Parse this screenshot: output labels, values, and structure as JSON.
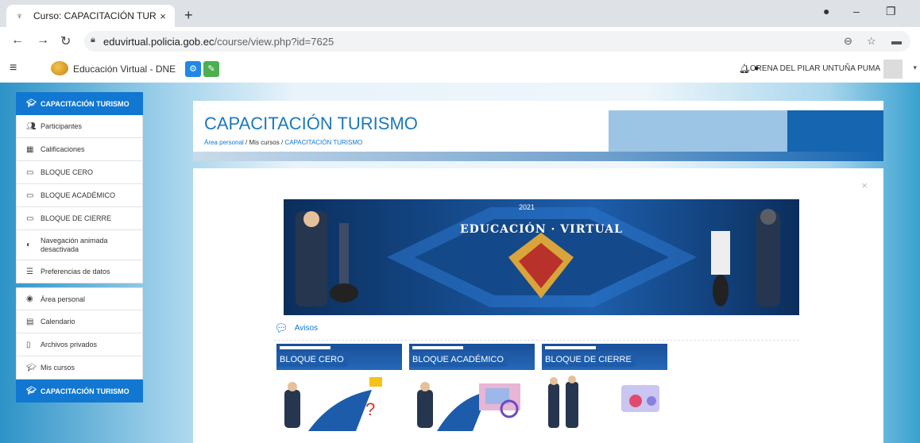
{
  "browser": {
    "tab_title": "Curso: CAPACITACIÓN TURISMO",
    "tab_close": "×",
    "new_tab": "+",
    "url_host": "eduvirtual.policia.gob.ec",
    "url_path": "/course/view.php?id=7625",
    "win_min": "–",
    "win_max": "❐"
  },
  "navbar": {
    "site_name": "Educación Virtual - DNE",
    "user_name": "LORENA DEL PILAR UNTUÑA PUMA"
  },
  "sidebar": {
    "items": [
      {
        "label": "CAPACITACIÓN TURISMO",
        "icon": "graduation-cap-icon"
      },
      {
        "label": "Participantes",
        "icon": "users-icon"
      },
      {
        "label": "Calificaciones",
        "icon": "table-icon"
      },
      {
        "label": "BLOQUE CERO",
        "icon": "folder-icon"
      },
      {
        "label": "BLOQUE ACADÉMICO",
        "icon": "folder-icon"
      },
      {
        "label": "BLOQUE DE CIERRE",
        "icon": "folder-icon"
      },
      {
        "label": "Navegación animada desactivada",
        "icon": "toggle-icon"
      },
      {
        "label": "Preferencias de datos",
        "icon": "database-icon"
      },
      {
        "label": "Área personal",
        "icon": "tachometer-icon"
      },
      {
        "label": "Calendario",
        "icon": "calendar-icon"
      },
      {
        "label": "Archivos privados",
        "icon": "file-icon"
      },
      {
        "label": "Mis cursos",
        "icon": "graduation-cap-icon"
      },
      {
        "label": "CAPACITACIÓN TURISMO",
        "icon": "graduation-cap-icon"
      }
    ]
  },
  "header": {
    "course_title": "CAPACITACIÓN TURISMO",
    "breadcrumb": [
      "Área personal",
      "Mis cursos",
      "CAPACITACIÓN TURISMO"
    ],
    "separator": "/"
  },
  "content": {
    "close": "×",
    "banner_year": "2021",
    "banner_title": "EDUCACIÓN · VIRTUAL",
    "avisos": "Avisos",
    "cards": [
      "BLOQUE CERO",
      "BLOQUE ACADÉMICO",
      "BLOQUE DE CIERRE"
    ]
  },
  "colors": {
    "accent": "#1177d1",
    "title_blue": "#1c79c0",
    "button_blue": "#1e88e5",
    "button_green": "#4caf50"
  }
}
